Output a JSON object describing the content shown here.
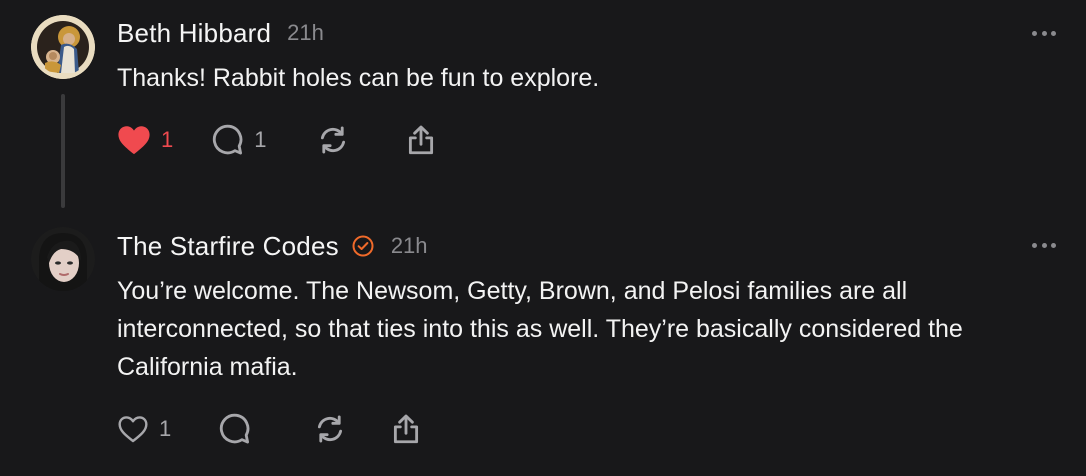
{
  "posts": [
    {
      "author": "Beth Hibbard",
      "time": "21h",
      "text": "Thanks! Rabbit holes can be fun to explore.",
      "verified": false,
      "liked": true,
      "likes": "1",
      "replies": "1",
      "avatar_icon": "religious-painting-avatar"
    },
    {
      "author": "The Starfire Codes",
      "time": "21h",
      "text": "You’re welcome. The Newsom, Getty, Brown, and Pelosi families are all interconnected, so that ties into this as well. They’re basically considered the California mafia.",
      "verified": true,
      "liked": false,
      "likes": "1",
      "replies": "",
      "avatar_icon": "woman-portrait-avatar"
    }
  ],
  "colors": {
    "background": "#18181a",
    "like_active": "#f04a4f",
    "verified": "#f06a2a",
    "muted": "#8a8a8e"
  }
}
